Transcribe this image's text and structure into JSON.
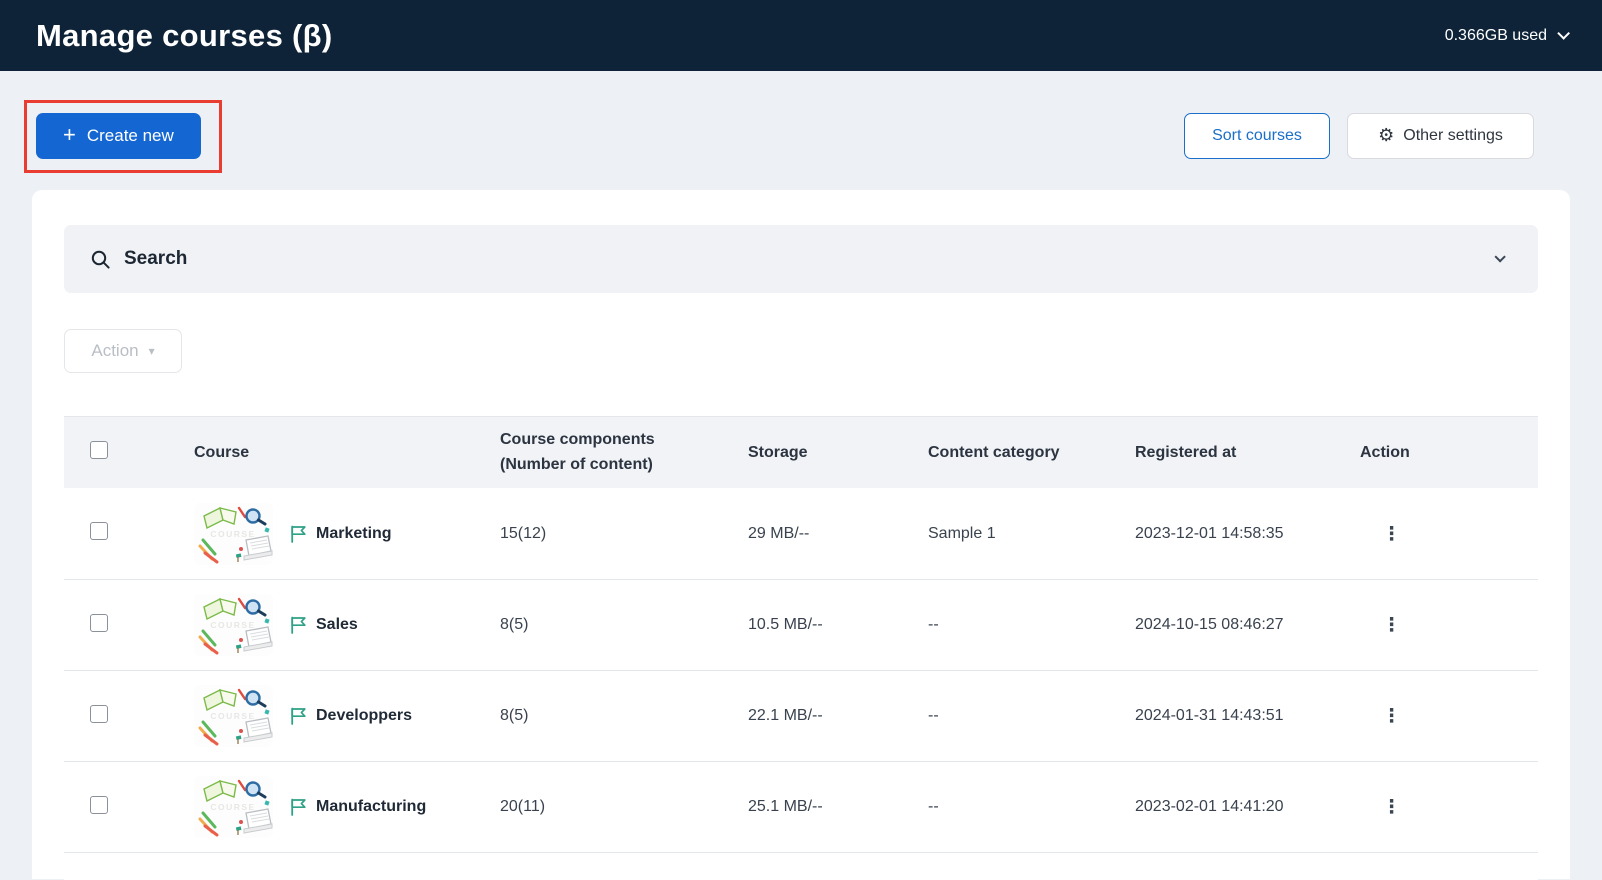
{
  "header": {
    "title": "Manage courses (β)",
    "storage_used": "0.366GB used"
  },
  "toolbar": {
    "create_new_label": "Create new",
    "sort_courses_label": "Sort courses",
    "other_settings_label": "Other settings"
  },
  "search": {
    "label": "Search"
  },
  "bulk_action": {
    "label": "Action"
  },
  "icons": {
    "plus": "+",
    "gear": "⚙",
    "caret_down": "▾",
    "kebab": "⋮"
  },
  "table": {
    "columns": {
      "course": "Course",
      "components_line1": "Course components",
      "components_line2": "(Number of content)",
      "storage": "Storage",
      "category": "Content category",
      "registered": "Registered at",
      "action": "Action"
    },
    "rows": [
      {
        "course": "Marketing",
        "components": "15(12)",
        "storage": "29 MB/--",
        "category": "Sample 1",
        "registered": "2023-12-01 14:58:35"
      },
      {
        "course": "Sales",
        "components": "8(5)",
        "storage": "10.5 MB/--",
        "category": "--",
        "registered": "2024-10-15 08:46:27"
      },
      {
        "course": "Developpers",
        "components": "8(5)",
        "storage": "22.1 MB/--",
        "category": "--",
        "registered": "2024-01-31 14:43:51"
      },
      {
        "course": "Manufacturing",
        "components": "20(11)",
        "storage": "25.1 MB/--",
        "category": "--",
        "registered": "2023-02-01 14:41:20"
      }
    ]
  },
  "colors": {
    "header_bg": "#0e2338",
    "primary_blue": "#1467d2",
    "outline_blue": "#1a6fc9",
    "annotation_red": "#e93d32",
    "flag_teal": "#2fa186",
    "page_bg": "#edf0f4",
    "panel_gray": "#f0f2f6"
  }
}
